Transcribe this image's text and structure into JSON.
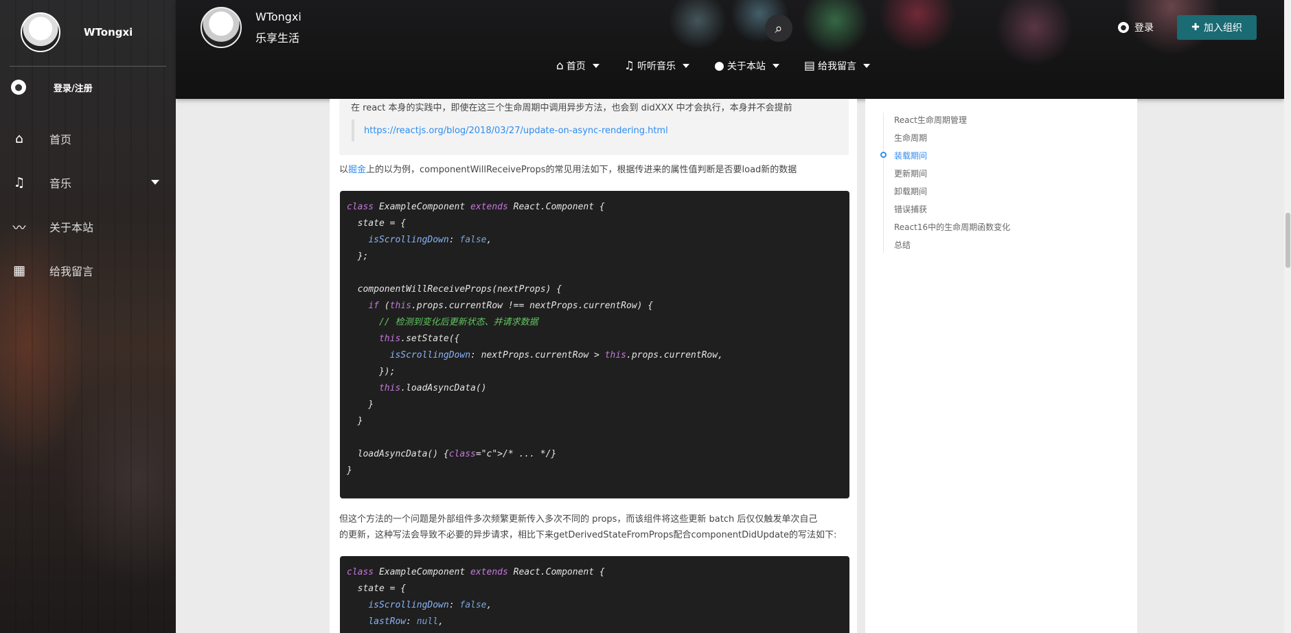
{
  "sidebar": {
    "name": "WTongxi",
    "login_label": "登录/注册",
    "items": [
      {
        "icon": "home-icon",
        "glyph": "⌂",
        "label": "首页"
      },
      {
        "icon": "music-icon",
        "glyph": "♫",
        "label": "音乐"
      },
      {
        "icon": "chart-line-icon",
        "glyph": "〰",
        "label": "关于本站"
      },
      {
        "icon": "calendar-icon",
        "glyph": "▦",
        "label": "给我留言"
      }
    ]
  },
  "header": {
    "name": "WTongxi",
    "slogan": "乐享生活",
    "login_label": "登录",
    "join_label": "加入组织",
    "nav": [
      {
        "glyph": "⌂",
        "label": "首页"
      },
      {
        "glyph": "♫",
        "label": "听听音乐"
      },
      {
        "glyph": "●",
        "label": "关于本站"
      },
      {
        "glyph": "▤",
        "label": "给我留言"
      }
    ]
  },
  "article": {
    "quote_text": "在 react 本身的实践中，即使在这三个生命周期中调用异步方法，也会到 didXXX 中才会执行，本身并不会提前",
    "quote_link": "https://reactjs.org/blog/2018/03/27/update-on-async-rendering.html",
    "para1_prefix": "以",
    "para1_link": "掘金",
    "para1_suffix": "上的以为例，componentWillReceiveProps的常见用法如下，根据传进来的属性值判断是否要load新的数据",
    "para2_line1": "但这个方法的一个问题是外部组件多次频繁更新传入多次不同的 props，而该组件将这些更新 batch 后仅仅触发单次自己",
    "para2_line2": "的更新，这种写法会导致不必要的异步请求，相比下来getDerivedStateFromProps配合componentDidUpdate的写法如下:",
    "code1": [
      "class ExampleComponent extends React.Component {",
      "  state = {",
      "    isScrollingDown: false,",
      "  };",
      "",
      "  componentWillReceiveProps(nextProps) {",
      "    if (this.props.currentRow !== nextProps.currentRow) {",
      "      // 检测到变化后更新状态、并请求数据",
      "      this.setState({",
      "        isScrollingDown: nextProps.currentRow > this.props.currentRow,",
      "      });",
      "      this.loadAsyncData()",
      "    }",
      "  }",
      "",
      "  loadAsyncData() {/* ... */}",
      "}"
    ],
    "code2": [
      "class ExampleComponent extends React.Component {",
      "  state = {",
      "    isScrollingDown: false,",
      "    lastRow: null,"
    ]
  },
  "toc": {
    "items": [
      {
        "label": "React生命周期管理",
        "active": false
      },
      {
        "label": "生命周期",
        "active": false
      },
      {
        "label": "装载期间",
        "active": true
      },
      {
        "label": "更新期间",
        "active": false
      },
      {
        "label": "卸载期间",
        "active": false
      },
      {
        "label": "错误捕获",
        "active": false
      },
      {
        "label": "React16中的生命周期函数变化",
        "active": false
      },
      {
        "label": "总结",
        "active": false
      }
    ]
  },
  "colors": {
    "accent": "#2d8cf0",
    "join_button": "#1a6b73",
    "code_bg": "#1f1f1f",
    "keyword": "#c678dd",
    "comment": "#61c561"
  }
}
